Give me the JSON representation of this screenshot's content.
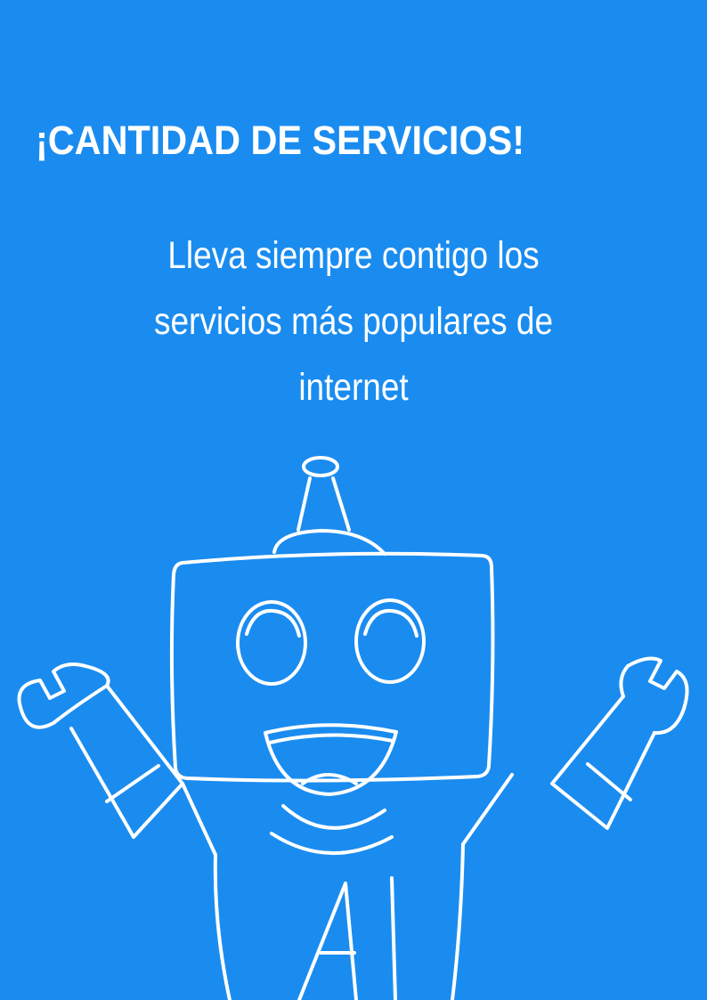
{
  "poster": {
    "background_color": "#1a8cf0",
    "text_color": "#ffffff",
    "title": "¡CANTIDAD DE SERVICIOS!",
    "subtitle_lines": [
      "Lleva siempre contigo los",
      "servicios más populares de",
      "internet"
    ],
    "illustration": {
      "icon": "robot-icon",
      "chest_text": "AI"
    }
  }
}
